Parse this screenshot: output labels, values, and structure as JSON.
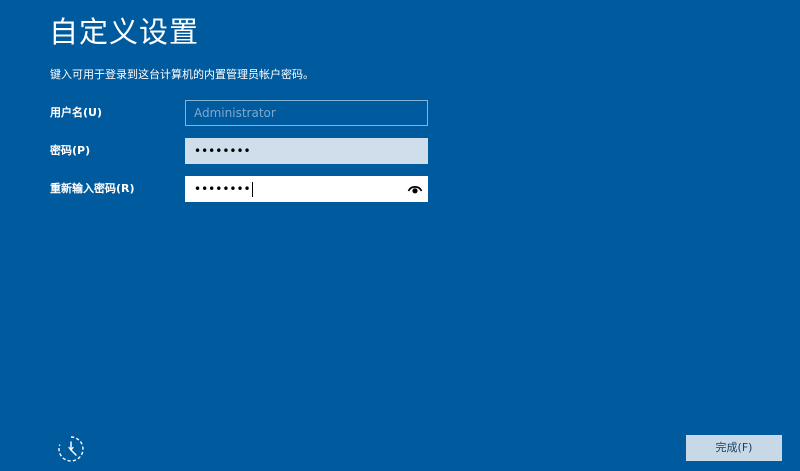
{
  "page": {
    "title": "自定义设置",
    "instruction": "键入可用于登录到这台计算机的内置管理员帐户密码。"
  },
  "fields": {
    "username": {
      "label": "用户名(U)",
      "value": "",
      "placeholder": "Administrator"
    },
    "password": {
      "label": "密码(P)",
      "masked_value": "••••••••"
    },
    "confirm_password": {
      "label": "重新输入密码(R)",
      "masked_value": "••••••••",
      "reveal_icon": "eye-icon"
    }
  },
  "footer": {
    "accessibility_icon": "ease-of-access-icon",
    "finish_label": "完成(F)"
  },
  "colors": {
    "background": "#005a9e",
    "text": "#ffffff",
    "password_field_bg": "#cfdeea",
    "finish_button_bg": "#c7d8e6"
  }
}
